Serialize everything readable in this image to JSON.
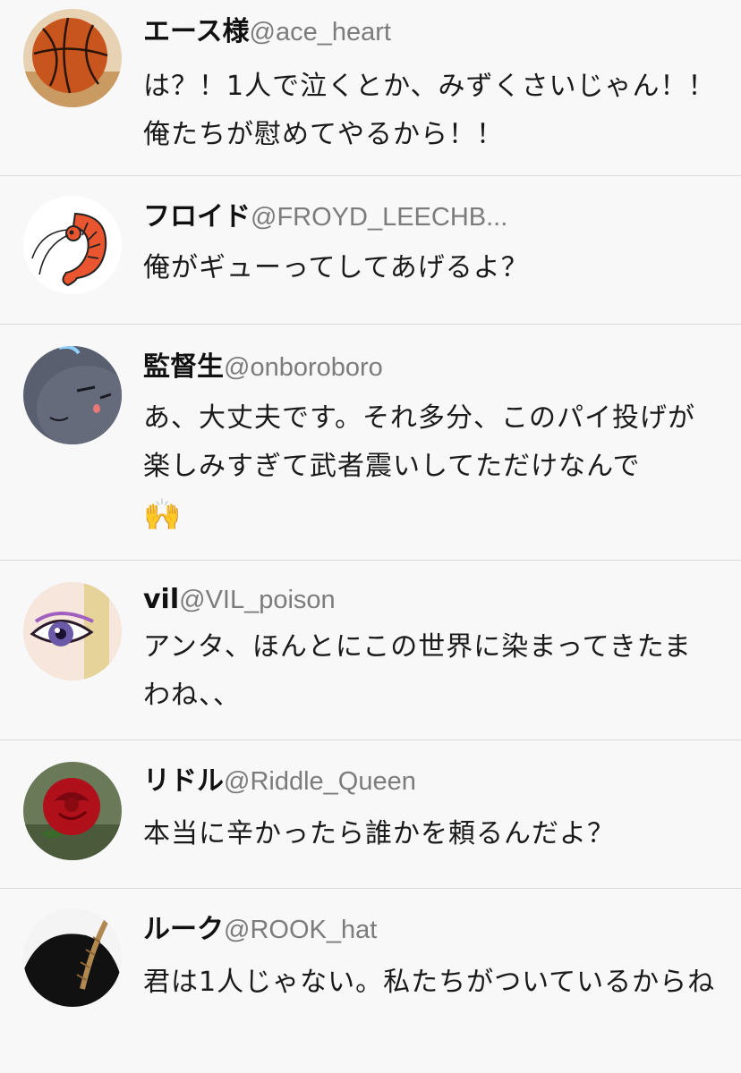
{
  "posts": [
    {
      "name": "エース様",
      "handle": "@ace_heart",
      "avatar_icon": "basketball-icon",
      "text": "は？！1人で泣くとか、みずくさいじゃん！！俺たちが慰めてやるから！！"
    },
    {
      "name": "フロイド",
      "handle": "@FROYD_LEECHB...",
      "avatar_icon": "shrimp-icon",
      "text": "俺がギューってしてあげるよ？"
    },
    {
      "name": "監督生",
      "handle": "@onboroboro",
      "avatar_icon": "gray-cat-icon",
      "text": "あ、大丈夫です。それ多分、このパイ投げが楽しみすぎて武者震いしてただけなんで",
      "emoji": "🙌"
    },
    {
      "name": "vil",
      "handle": "@VIL_poison",
      "avatar_icon": "eye-icon",
      "text": "アンタ、ほんとにこの世界に染まってきたまわね、、"
    },
    {
      "name": "リドル",
      "handle": "@Riddle_Queen",
      "avatar_icon": "red-rose-icon",
      "text": "本当に辛かったら誰かを頼るんだよ？"
    },
    {
      "name": "ルーク",
      "handle": "@ROOK_hat",
      "avatar_icon": "feather-hat-icon",
      "text": "君は1人じゃない。私たちがついているからね"
    }
  ]
}
